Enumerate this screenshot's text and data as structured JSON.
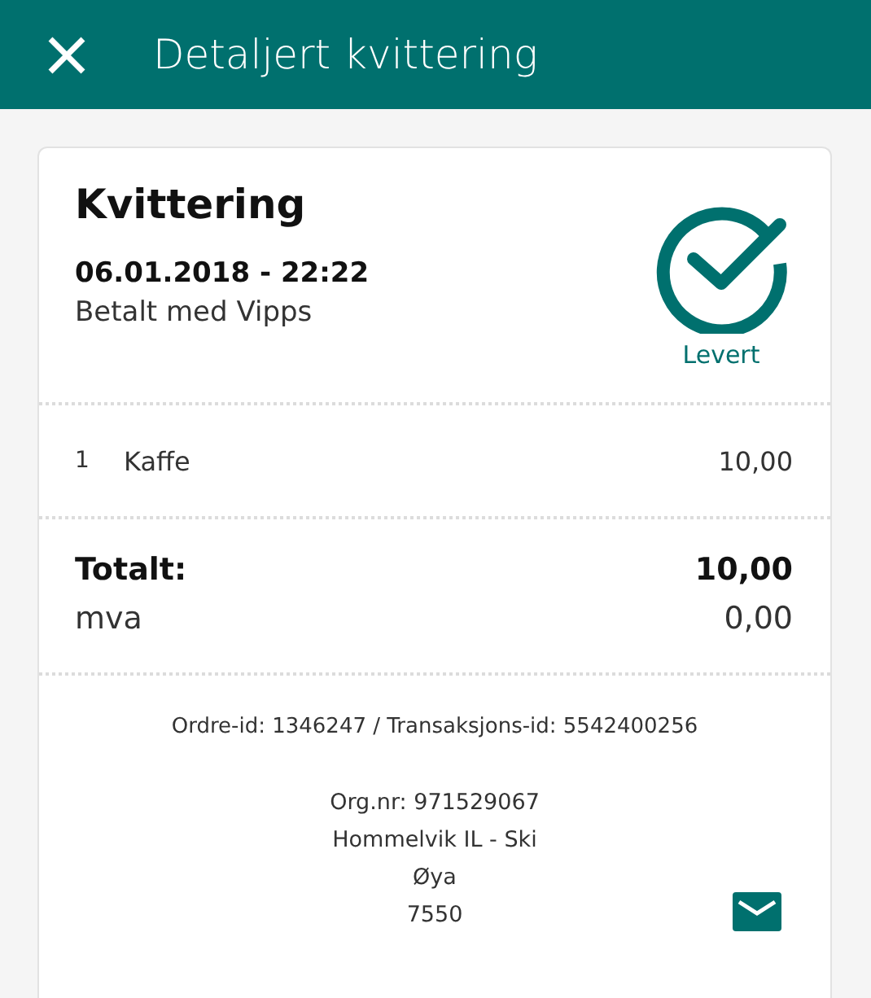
{
  "header": {
    "title": "Detaljert kvittering"
  },
  "receipt": {
    "title": "Kvittering",
    "datetime": "06.01.2018 - 22:22",
    "payment": "Betalt med Vipps",
    "status": "Levert"
  },
  "items": [
    {
      "quantity": "1",
      "name": "Kaffe",
      "amount": "10,00"
    }
  ],
  "totals": [
    {
      "kind": "total",
      "label": "Totalt:",
      "amount": "10,00"
    },
    {
      "kind": "tax",
      "label": "mva",
      "amount": "0,00"
    }
  ],
  "ids": "Ordre-id: 1346247 / Transaksjons-id: 5542400256",
  "merchant": [
    "Org.nr: 971529067",
    "Hommelvik IL - Ski",
    "Øya",
    "7550"
  ]
}
